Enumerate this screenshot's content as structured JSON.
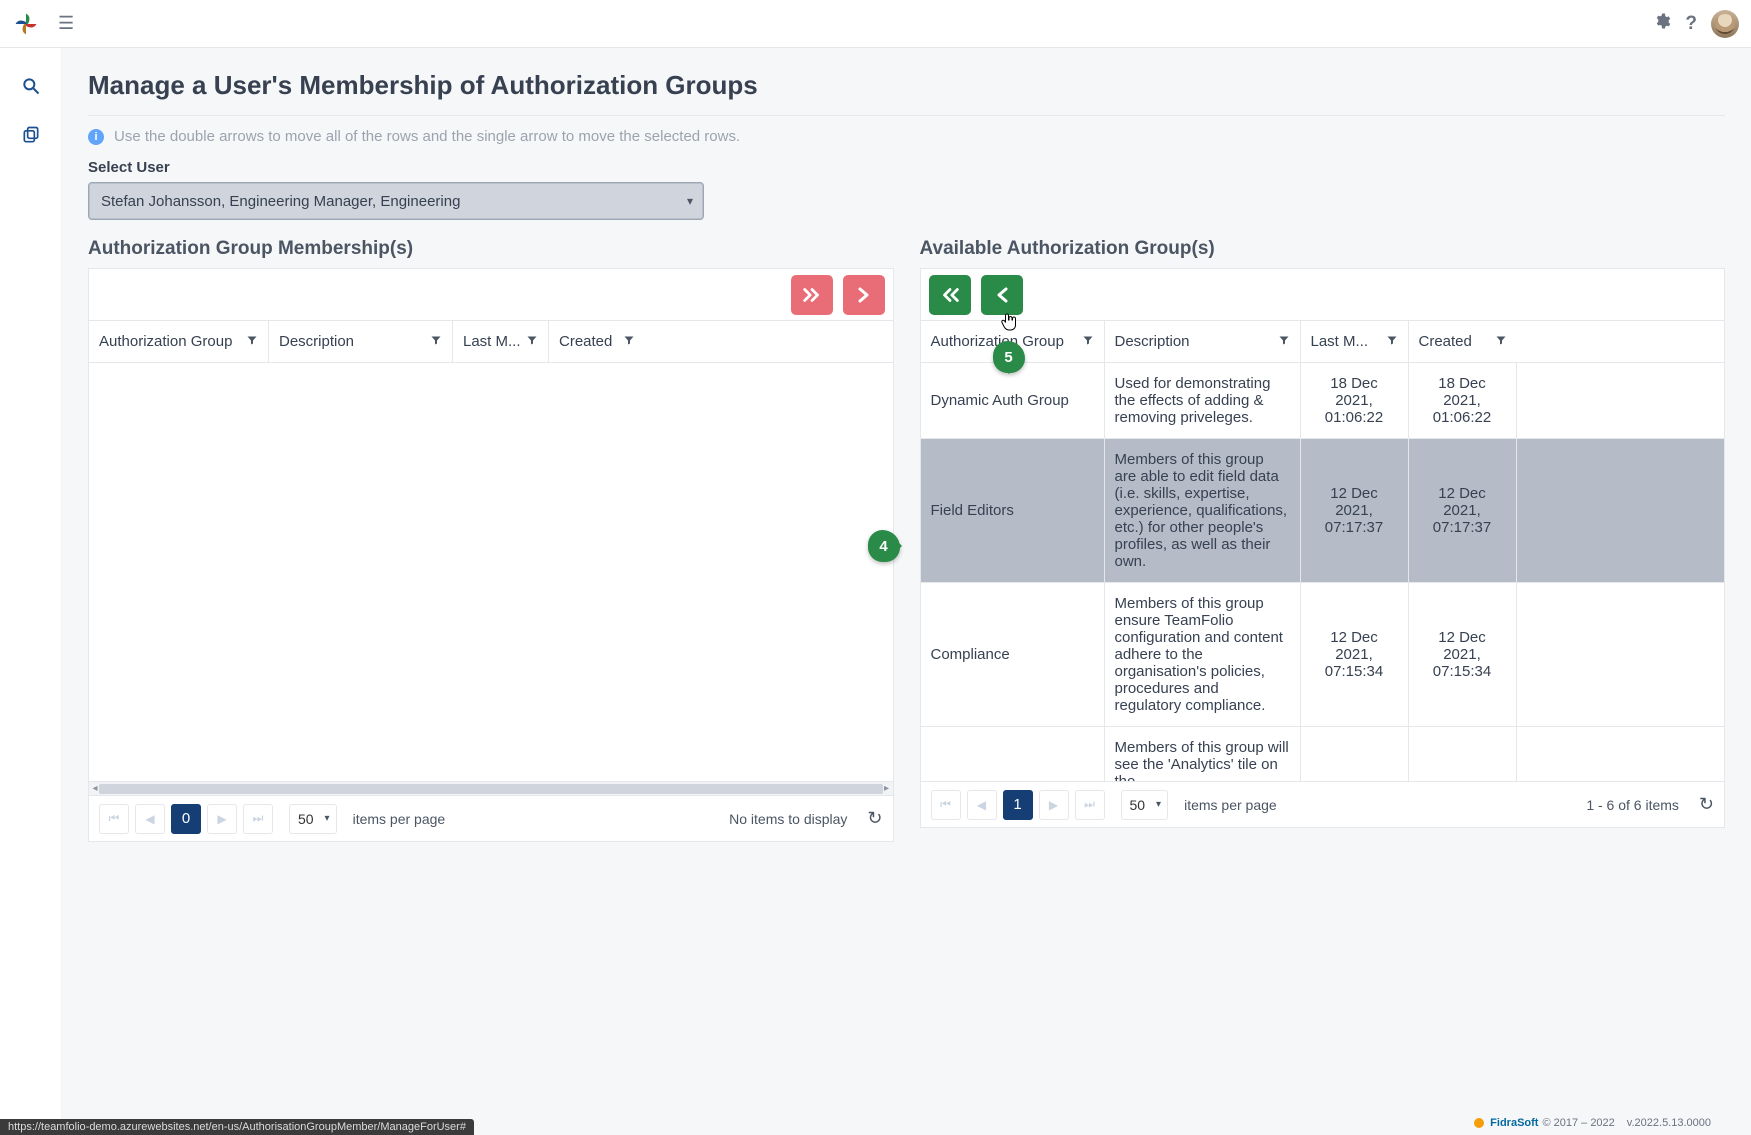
{
  "header": {},
  "page": {
    "title": "Manage a User's Membership of Authorization Groups",
    "info_text": "Use the double arrows to move all of the rows and the single arrow to move the selected rows.",
    "select_label": "Select User",
    "selected_user": "Stefan Johansson, Engineering Manager, Engineering"
  },
  "callouts": {
    "c4": "4",
    "c5": "5"
  },
  "left": {
    "title": "Authorization Group Membership(s)",
    "columns": {
      "c0": "Authorization Group",
      "c1": "Description",
      "c2": "Last M...",
      "c3": "Created"
    },
    "pager": {
      "page": "0",
      "page_size": "50",
      "ipp": "items per page",
      "status": "No items to display"
    }
  },
  "right": {
    "title": "Available Authorization Group(s)",
    "columns": {
      "c0": "Authorization Group",
      "c1": "Description",
      "c2": "Last M...",
      "c3": "Created"
    },
    "rows": [
      {
        "group": "Dynamic Auth Group",
        "desc": "Used for demonstrating the effects of adding & removing priveleges.",
        "modified": "18 Dec 2021, 01:06:22",
        "created": "18 Dec 2021, 01:06:22",
        "selected": false
      },
      {
        "group": "Field Editors",
        "desc": "Members of this group are able to edit field data (i.e. skills, expertise, experience, qualifications, etc.) for other people's profiles, as well as their own.",
        "modified": "12 Dec 2021, 07:17:37",
        "created": "12 Dec 2021, 07:17:37",
        "selected": true
      },
      {
        "group": "Compliance",
        "desc": "Members of this group ensure TeamFolio configuration and content adhere to the organisation's policies, procedures and regulatory compliance.",
        "modified": "12 Dec 2021, 07:15:34",
        "created": "12 Dec 2021, 07:15:34",
        "selected": false
      },
      {
        "group": "",
        "desc": "Members of this group will see the 'Analytics' tile on the",
        "modified": "",
        "created": "",
        "selected": false
      }
    ],
    "pager": {
      "page": "1",
      "page_size": "50",
      "ipp": "items per page",
      "status": "1 - 6 of 6 items"
    }
  },
  "footer": {
    "brand": "FidraSoft",
    "copyright": "© 2017 – 2022",
    "version": "v.2022.5.13.0000"
  },
  "status_url": "https://teamfolio-demo.azurewebsites.net/en-us/AuthorisationGroupMember/ManageForUser#"
}
